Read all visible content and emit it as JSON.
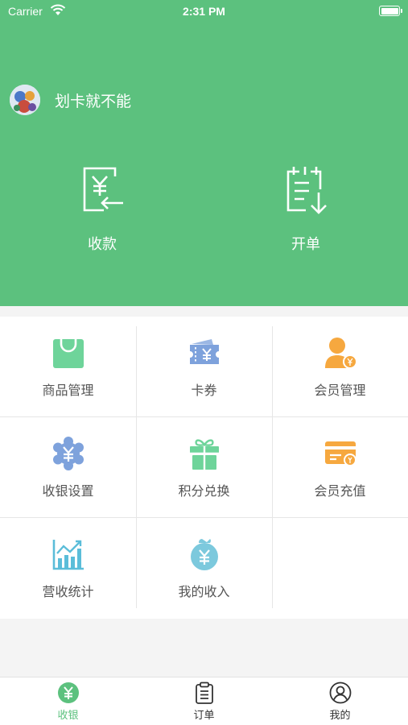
{
  "status_bar": {
    "carrier": "Carrier",
    "time": "2:31 PM"
  },
  "user": {
    "name": "划卡就不能"
  },
  "actions": [
    {
      "label": "收款",
      "icon": "receive-payment-icon"
    },
    {
      "label": "开单",
      "icon": "create-order-icon"
    }
  ],
  "menu": [
    {
      "label": "商品管理",
      "icon": "shopping-bag-icon",
      "color": "#6ed49a"
    },
    {
      "label": "卡券",
      "icon": "coupon-ticket-icon",
      "color": "#7ea2dc"
    },
    {
      "label": "会员管理",
      "icon": "member-user-icon",
      "color": "#f6a83f"
    },
    {
      "label": "收银设置",
      "icon": "yen-settings-gear-icon",
      "color": "#7ea2dc"
    },
    {
      "label": "积分兑换",
      "icon": "gift-box-icon",
      "color": "#6ed49a"
    },
    {
      "label": "会员充值",
      "icon": "card-recharge-icon",
      "color": "#f6a83f"
    },
    {
      "label": "营收统计",
      "icon": "bar-chart-icon",
      "color": "#5bbdd9"
    },
    {
      "label": "我的收入",
      "icon": "money-bag-icon",
      "color": "#7cc9dd"
    }
  ],
  "tabs": [
    {
      "label": "收银",
      "icon": "yen-circle-icon",
      "active": true
    },
    {
      "label": "订单",
      "icon": "clipboard-icon",
      "active": false
    },
    {
      "label": "我的",
      "icon": "profile-icon",
      "active": false
    }
  ],
  "colors": {
    "brand": "#5cc17e",
    "active_tab": "#5cc17e"
  }
}
